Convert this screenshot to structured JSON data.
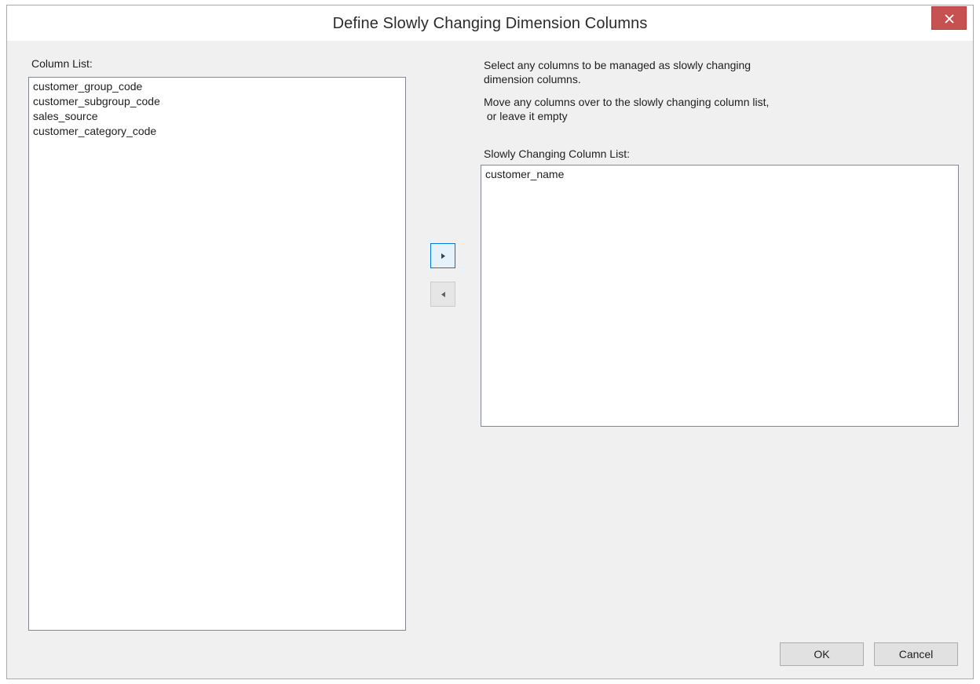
{
  "window": {
    "title": "Define Slowly Changing Dimension Columns",
    "close_label": "close"
  },
  "column_list": {
    "label": "Column List:",
    "items": [
      "customer_group_code",
      "customer_subgroup_code",
      "sales_source",
      "customer_category_code"
    ]
  },
  "instructions": {
    "line1": "Select any columns to be managed as slowly changing",
    "line2": "dimension columns.",
    "line3": "Move any columns over to the slowly changing column list,",
    "line4": " or leave it empty"
  },
  "slowly_changing_list": {
    "label": "Slowly Changing Column List:",
    "items": [
      "customer_name"
    ]
  },
  "buttons": {
    "ok_label": "OK",
    "cancel_label": "Cancel"
  },
  "icons": {
    "close": "close-icon",
    "move_right": "triangle-right-icon",
    "move_left": "triangle-left-icon"
  },
  "colors": {
    "close_button": "#c75050",
    "dialog_background": "#f0f0f0",
    "active_accent": "#0078d7"
  }
}
